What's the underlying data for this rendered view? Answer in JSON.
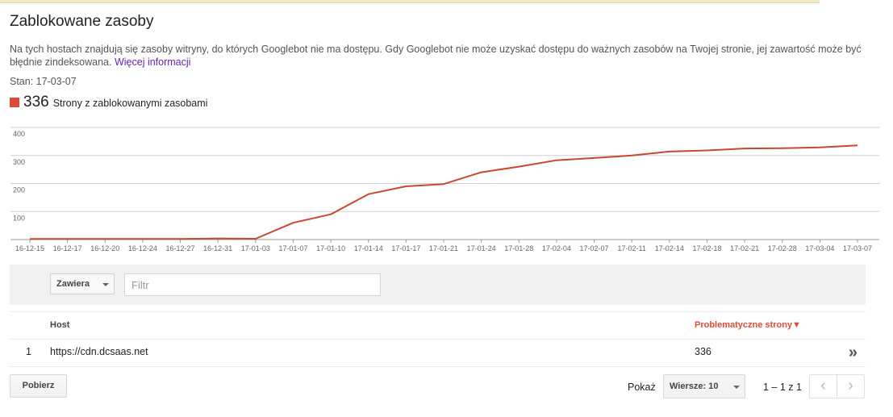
{
  "page": {
    "title": "Zablokowane zasoby",
    "description": "Na tych hostach znajdują się zasoby witryny, do których Googlebot nie ma dostępu. Gdy Googlebot nie może uzyskać dostępu do ważnych zasobów na Twojej stronie, jej zawartość może być błędnie zindeksowana.",
    "more_link": "Więcej informacji",
    "status": "Stan: 17-03-07"
  },
  "summary": {
    "count": "336",
    "label": "Strony z zablokowanymi zasobami",
    "color": "#dd4b39"
  },
  "chart_data": {
    "type": "line",
    "x": [
      "16-12-15",
      "16-12-17",
      "16-12-20",
      "16-12-24",
      "16-12-27",
      "16-12-31",
      "17-01-03",
      "17-01-07",
      "17-01-10",
      "17-01-14",
      "17-01-17",
      "17-01-21",
      "17-01-24",
      "17-01-28",
      "17-02-04",
      "17-02-07",
      "17-02-11",
      "17-02-14",
      "17-02-18",
      "17-02-21",
      "17-02-28",
      "17-03-04",
      "17-03-07"
    ],
    "series": [
      {
        "values": [
          2,
          2,
          2,
          2,
          2,
          4,
          3,
          60,
          90,
          162,
          190,
          198,
          240,
          260,
          283,
          291,
          300,
          314,
          318,
          325,
          326,
          329,
          336
        ]
      }
    ],
    "yticks": [
      "400",
      "300",
      "200",
      "100"
    ],
    "ylim": [
      0,
      400
    ],
    "grid": true,
    "color": "#c8482f"
  },
  "filter": {
    "mode": "Zawiera",
    "placeholder": "Filtr",
    "value": ""
  },
  "table": {
    "columns": {
      "host": "Host",
      "pages": "Problematyczne strony▼"
    },
    "rows": [
      {
        "index": "1",
        "host": "https://cdn.dcsaas.net",
        "pages": "336"
      }
    ],
    "row_action": "»"
  },
  "footer": {
    "download": "Pobierz",
    "show_label": "Pokaż",
    "rows_per_page": "Wiersze: 10",
    "range": "1 – 1 z 1",
    "prev": "‹",
    "next": "›"
  }
}
